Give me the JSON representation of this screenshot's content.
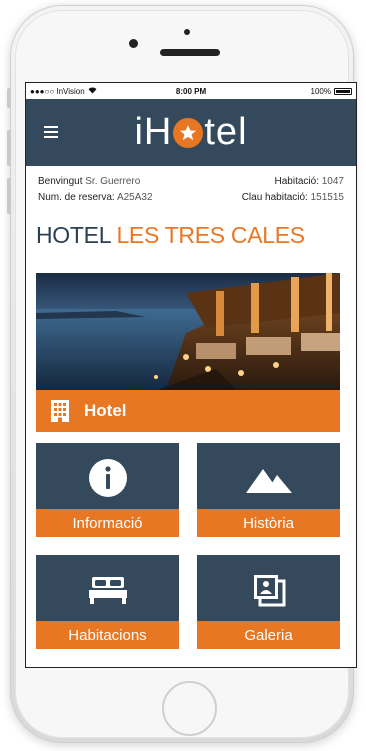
{
  "status_bar": {
    "carrier": "●●●○○ InVision",
    "time": "8:00 PM",
    "battery": "100%"
  },
  "header": {
    "logo_prefix": "iH",
    "logo_suffix": "tel"
  },
  "guest": {
    "welcome_label": "Benvingut",
    "welcome_name": "Sr. Guerrero",
    "room_label": "Habitació:",
    "room_value": "1047",
    "reservation_label": "Num. de reserva:",
    "reservation_value": "A25A32",
    "room_key_label": "Clau habitació:",
    "room_key_value": "151515"
  },
  "hotel_title": {
    "part1": "HOTEL",
    "part2": "LES TRES CALES"
  },
  "hotel_bar": {
    "label": "Hotel",
    "icon": "building-icon"
  },
  "tiles": [
    {
      "label": "Informació",
      "icon": "info-icon"
    },
    {
      "label": "Història",
      "icon": "mountains-icon"
    },
    {
      "label": "Habitacions",
      "icon": "bed-icon"
    },
    {
      "label": "Galeria",
      "icon": "photos-icon"
    }
  ],
  "colors": {
    "navy": "#344a5c",
    "orange": "#e87724"
  }
}
